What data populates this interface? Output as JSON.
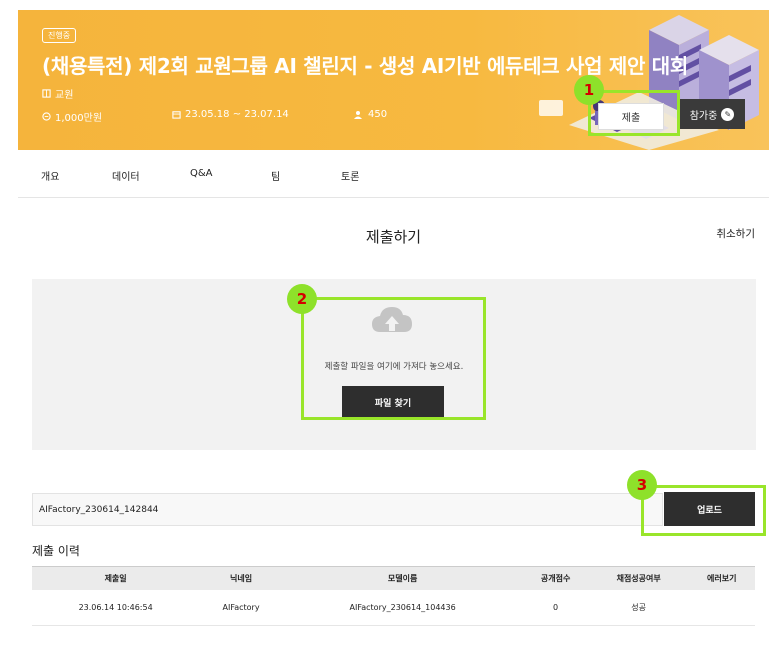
{
  "banner": {
    "status_badge": "진행중",
    "title": "(채용특전) 제2회 교원그룹 AI 챌린지 - 생성 AI기반 에듀테크 사업 제안 대회",
    "organizer": "교원",
    "prize": "1,000만원",
    "period": "23.05.18 ~ 23.07.14",
    "participants": "450",
    "submit_label": "제출",
    "joined_label": "참가중",
    "bg_color": "#f5b43c"
  },
  "tabs": [
    {
      "label": "개요"
    },
    {
      "label": "데이터"
    },
    {
      "label": "Q&A"
    },
    {
      "label": "팀"
    },
    {
      "label": "토론"
    }
  ],
  "submit_panel": {
    "title": "제출하기",
    "cancel_label": "취소하기",
    "drop_text": "제출할 파일을 여기에 가져다 놓으세요.",
    "find_button": "파일 찾기",
    "file_value": "AIFactory_230614_142844",
    "upload_button": "업로드"
  },
  "history": {
    "title": "제출 이력",
    "columns": [
      "제출일",
      "닉네임",
      "모델이름",
      "공개점수",
      "채점성공여부",
      "에러보기"
    ],
    "rows": [
      [
        "23.06.14 10:46:54",
        "AIFactory",
        "AIFactory_230614_104436",
        "0",
        "성공",
        ""
      ]
    ]
  },
  "annotations": {
    "marker_1": "1",
    "marker_2": "2",
    "marker_3": "3",
    "highlight_color": "#99e52a",
    "number_color": "#d40000"
  }
}
